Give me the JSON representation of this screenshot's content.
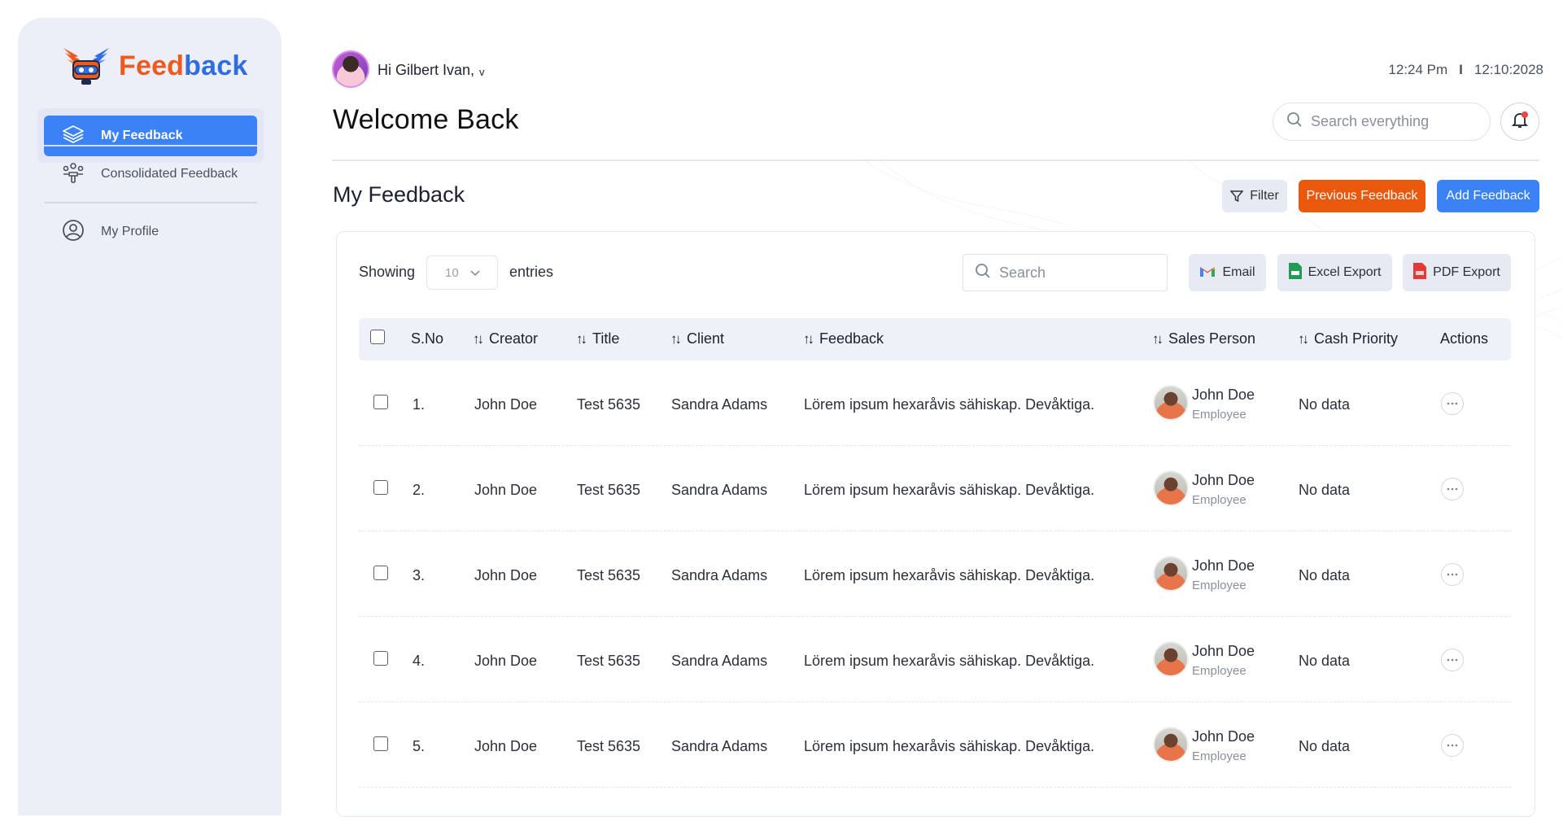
{
  "app": {
    "logo_text_a": "Feed",
    "logo_text_b": "back"
  },
  "sidebar": {
    "items": [
      {
        "label": "My Feedback",
        "icon": "layers-icon",
        "active": true
      },
      {
        "label": "Consolidated Feedback",
        "icon": "team-icon",
        "active": false
      },
      {
        "label": "My Profile",
        "icon": "user-circle-icon",
        "active": false
      }
    ]
  },
  "header": {
    "greeting": "Hi Gilbert Ivan,",
    "greeting_chevron": "v",
    "time": "12:24 Pm",
    "separator": "I",
    "date": "12:10:2028",
    "title": "Welcome Back",
    "search_placeholder": "Search everything"
  },
  "section": {
    "title": "My Feedback",
    "filter_label": "Filter",
    "previous_label": "Previous Feedback",
    "add_label": "Add Feedback"
  },
  "toolbar": {
    "showing_label": "Showing",
    "entries_value": "10",
    "entries_label": "entries",
    "search_placeholder": "Search",
    "email_label": "Email",
    "excel_label": "Excel Export",
    "pdf_label": "PDF Export"
  },
  "table": {
    "columns": [
      "S.No",
      "Creator",
      "Title",
      "Client",
      "Feedback",
      "Sales Person",
      "Cash Priority",
      "Actions"
    ],
    "rows": [
      {
        "sno": "1.",
        "creator": "John Doe",
        "title": "Test 5635",
        "client": "Sandra Adams",
        "feedback": "Lörem ipsum hexaråvis sähiskap. Devåktiga.",
        "sp_name": "John Doe",
        "sp_role": "Employee",
        "cash_priority": "No data"
      },
      {
        "sno": "2.",
        "creator": "John Doe",
        "title": "Test 5635",
        "client": "Sandra Adams",
        "feedback": "Lörem ipsum hexaråvis sähiskap. Devåktiga.",
        "sp_name": "John Doe",
        "sp_role": "Employee",
        "cash_priority": "No data"
      },
      {
        "sno": "3.",
        "creator": "John Doe",
        "title": "Test 5635",
        "client": "Sandra Adams",
        "feedback": "Lörem ipsum hexaråvis sähiskap. Devåktiga.",
        "sp_name": "John Doe",
        "sp_role": "Employee",
        "cash_priority": "No data"
      },
      {
        "sno": "4.",
        "creator": "John Doe",
        "title": "Test 5635",
        "client": "Sandra Adams",
        "feedback": "Lörem ipsum hexaråvis sähiskap. Devåktiga.",
        "sp_name": "John Doe",
        "sp_role": "Employee",
        "cash_priority": "No data"
      },
      {
        "sno": "5.",
        "creator": "John Doe",
        "title": "Test 5635",
        "client": "Sandra Adams",
        "feedback": "Lörem ipsum hexaråvis sähiskap. Devåktiga.",
        "sp_name": "John Doe",
        "sp_role": "Employee",
        "cash_priority": "No data"
      }
    ]
  },
  "colors": {
    "primary": "#3b82f6",
    "accent": "#ea580c",
    "sidebar_bg": "#eceef8"
  }
}
